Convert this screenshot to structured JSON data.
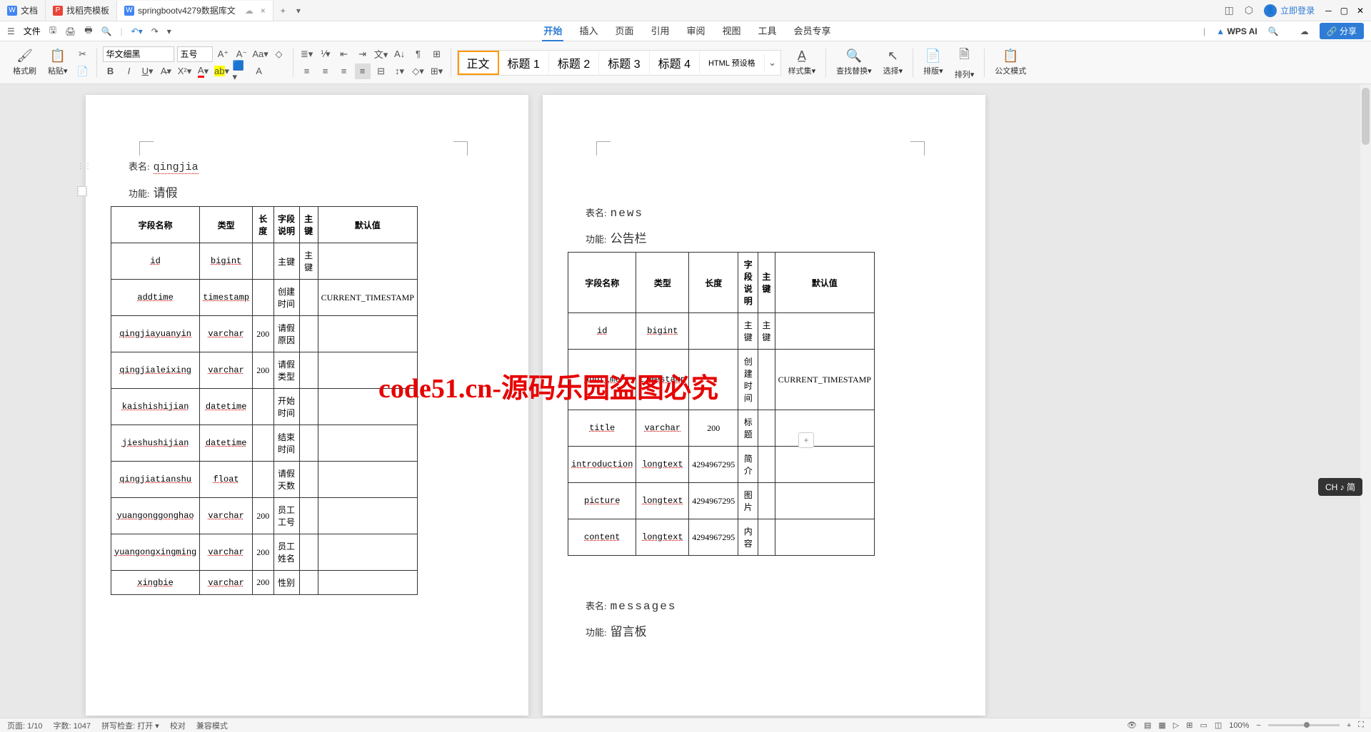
{
  "tabs": [
    {
      "icon": "W",
      "iconClass": "blue",
      "label": "文档"
    },
    {
      "icon": "P",
      "iconClass": "red",
      "label": "找稻壳模板"
    },
    {
      "icon": "W",
      "iconClass": "bluew",
      "label": "springbootv4279数据库文"
    }
  ],
  "login_label": "立即登录",
  "file_menu": "文件",
  "menu_tabs": [
    "开始",
    "插入",
    "页面",
    "引用",
    "审阅",
    "视图",
    "工具",
    "会员专享"
  ],
  "wps_ai": "WPS AI",
  "share_label": "分享",
  "toolbar": {
    "format_painter": "格式刷",
    "paste": "粘贴",
    "font": "华文细黑",
    "size": "五号",
    "style_normal": "正文",
    "style_h1": "标题 1",
    "style_h2": "标题 2",
    "style_h3": "标题 3",
    "style_h4": "标题 4",
    "style_html": "HTML 预设格",
    "styles": "样式集",
    "find_replace": "查找替换",
    "select": "选择",
    "layout": "排版",
    "arrange": "排列",
    "official": "公文模式"
  },
  "page1": {
    "table_name_label": "表名:",
    "table_name": "qingjia",
    "func_label": "功能:",
    "func": "请假",
    "headers": [
      "字段名称",
      "类型",
      "长度",
      "字段说明",
      "主键",
      "默认值"
    ],
    "rows": [
      [
        "id",
        "bigint",
        "",
        "主键",
        "主键",
        ""
      ],
      [
        "addtime",
        "timestamp",
        "",
        "创建时间",
        "",
        "CURRENT_TIMESTAMP"
      ],
      [
        "qingjiayuanyin",
        "varchar",
        "200",
        "请假原因",
        "",
        ""
      ],
      [
        "qingjialeixing",
        "varchar",
        "200",
        "请假类型",
        "",
        ""
      ],
      [
        "kaishishijian",
        "datetime",
        "",
        "开始时间",
        "",
        ""
      ],
      [
        "jieshushijian",
        "datetime",
        "",
        "结束时间",
        "",
        ""
      ],
      [
        "qingjiatianshu",
        "float",
        "",
        "请假天数",
        "",
        ""
      ],
      [
        "yuangonggonghao",
        "varchar",
        "200",
        "员工工号",
        "",
        ""
      ],
      [
        "yuangongxingming",
        "varchar",
        "200",
        "员工姓名",
        "",
        ""
      ],
      [
        "xingbie",
        "varchar",
        "200",
        "性别",
        "",
        ""
      ]
    ]
  },
  "page2": {
    "table1": {
      "table_name_label": "表名:",
      "table_name": "news",
      "func_label": "功能:",
      "func": "公告栏",
      "headers": [
        "字段名称",
        "类型",
        "长度",
        "字段说明",
        "主键",
        "默认值"
      ],
      "rows": [
        [
          "id",
          "bigint",
          "",
          "主键",
          "主键",
          ""
        ],
        [
          "addtime",
          "timestamp",
          "",
          "创建时间",
          "",
          "CURRENT_TIMESTAMP"
        ],
        [
          "title",
          "varchar",
          "200",
          "标题",
          "",
          ""
        ],
        [
          "introduction",
          "longtext",
          "4294967295",
          "简介",
          "",
          ""
        ],
        [
          "picture",
          "longtext",
          "4294967295",
          "图片",
          "",
          ""
        ],
        [
          "content",
          "longtext",
          "4294967295",
          "内容",
          "",
          ""
        ]
      ]
    },
    "table2": {
      "table_name_label": "表名:",
      "table_name": "messages",
      "func_label": "功能:",
      "func": "留言板"
    }
  },
  "watermark": "code51.cn-源码乐园盗图必究",
  "status": {
    "page": "页面: 1/10",
    "word_count": "字数: 1047",
    "spell_check": "拼写检查: 打开",
    "proofreading": "校对",
    "compat": "兼容模式",
    "zoom": "100%"
  },
  "ime": "CH ♪ 简"
}
